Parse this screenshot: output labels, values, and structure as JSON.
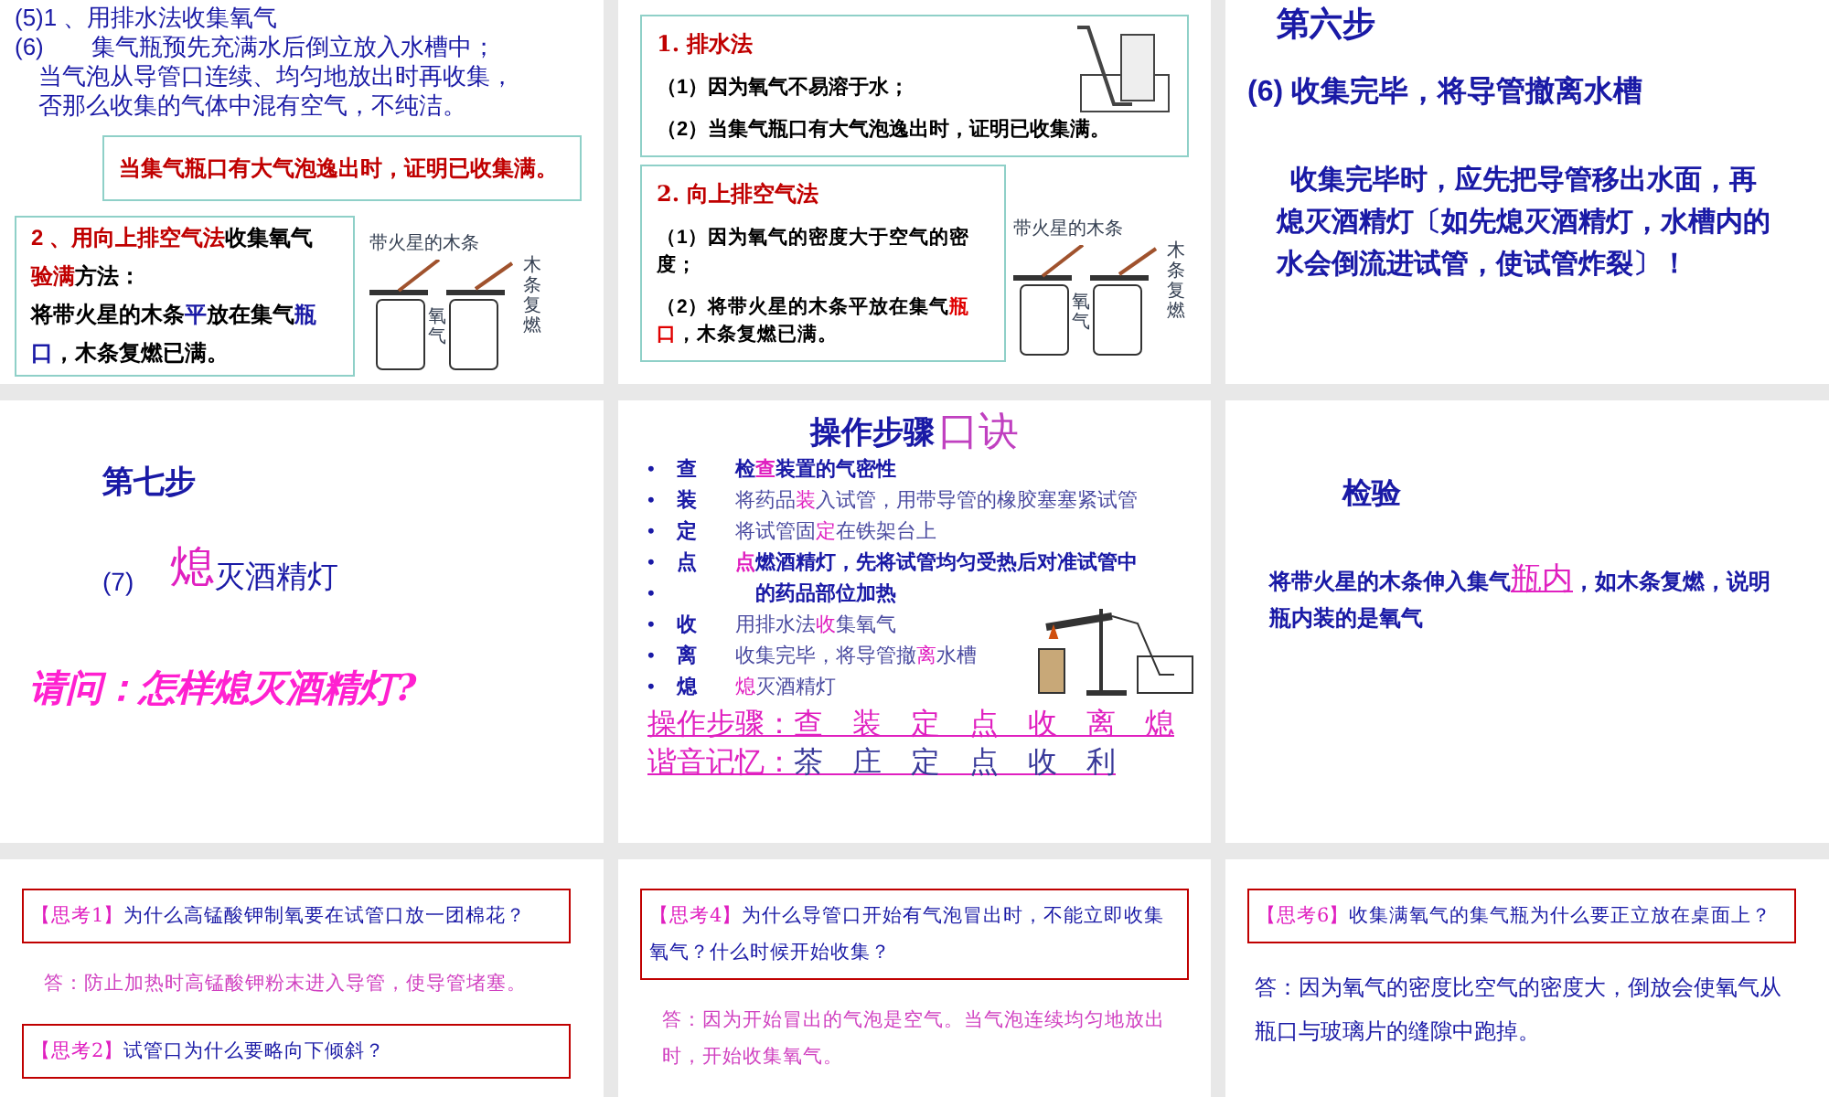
{
  "slides": [
    {
      "kind": "water-method",
      "lines": [
        [
          {
            "t": "(5)1 、用排水法收集氧气",
            "color": "#1a1aa6"
          }
        ],
        [
          {
            "t": "(6)　　集气瓶预先充满水后倒立放入水槽中；",
            "color": "#1a1aa6"
          }
        ],
        [
          {
            "t": "　当气泡从导管口连续、均匀地放出时再收集，",
            "color": "#1a1aa6"
          }
        ],
        [
          {
            "t": "　否那么收集的气体中混有空气，不纯洁。",
            "color": "#1a1aa6"
          }
        ]
      ],
      "note": "当集气瓶口有大气泡逸出时，证明已收集满。",
      "box": [
        [
          {
            "t": "2 、用",
            "color": "#c00000"
          },
          {
            "t": "向上排空气法",
            "color": "#c00000"
          },
          {
            "t": "收集氧气",
            "color": "#000000"
          }
        ],
        [
          {
            "t": "验满",
            "color": "#c00000"
          },
          {
            "t": "方法：",
            "color": "#000000"
          }
        ],
        [
          {
            "t": "将带火星的木条",
            "color": "#000000"
          },
          {
            "t": "平",
            "color": "#1a1aa6"
          },
          {
            "t": "放在集气",
            "color": "#000000"
          },
          {
            "t": "瓶",
            "color": "#1a1aa6"
          }
        ],
        [
          {
            "t": "口",
            "color": "#1a1aa6"
          },
          {
            "t": "，木条复燃已满。",
            "color": "#000000"
          }
        ]
      ],
      "figure": {
        "top_label": "带火星的木条",
        "gas_label": "氧气",
        "side_label": "木条复燃"
      }
    },
    {
      "kind": "methods",
      "sections": [
        {
          "heading": "1.  排水法",
          "lines": [
            [
              {
                "t": "（1）因为氧气不易溶于水；",
                "color": "#000000"
              }
            ],
            [
              {
                "t": "（2）当集气瓶口有大气泡逸出时，证明已收集满。",
                "color": "#000000"
              }
            ]
          ]
        },
        {
          "heading": "2. 向上排空气法",
          "lines": [
            [
              {
                "t": "（1）因为氧气的密度大于空气的密度；",
                "color": "#000000"
              }
            ],
            [
              {
                "t": "（2）将带火星的木条平放在集气",
                "color": "#000000"
              },
              {
                "t": "瓶口",
                "color": "#e00000"
              },
              {
                "t": "，木条复燃已满。",
                "color": "#000000"
              }
            ]
          ]
        }
      ],
      "figure": {
        "top_label": "带火星的木条",
        "gas_label": "氧气",
        "side_label": "木条复燃"
      }
    },
    {
      "kind": "step",
      "title": "第六步",
      "step": "(6)  收集完毕，将导管撤离水槽",
      "body": "收集完毕时，应先把导管移出水面，再熄灭酒精灯〔如先熄灭酒精灯，水槽内的水会倒流进试管，使试管炸裂〕！"
    },
    {
      "kind": "step7",
      "title": "第七步",
      "number": "(7)",
      "key": "熄",
      "rest": "灭酒精灯",
      "question": "请问：怎样熄灭酒精灯?"
    },
    {
      "kind": "mnemonic",
      "title": "操作步骤",
      "title_accent": "口诀",
      "items": [
        {
          "marker": "•",
          "key": "查",
          "runs": [
            {
              "t": "检",
              "color": "#1a1aa6"
            },
            {
              "t": "查",
              "color": "#e020c0"
            },
            {
              "t": "装置的气密性",
              "color": "#1a1aa6"
            }
          ]
        },
        {
          "marker": "•",
          "key": "装",
          "runs": [
            {
              "t": "将药品",
              "color": "#4a4aa0"
            },
            {
              "t": "装",
              "color": "#e020c0"
            },
            {
              "t": "入试管，用带导管的橡胶塞塞紧试管",
              "color": "#4a4aa0"
            }
          ]
        },
        {
          "marker": "•",
          "key": "定",
          "runs": [
            {
              "t": "将试管固",
              "color": "#4a4aa0"
            },
            {
              "t": "定",
              "color": "#e020c0"
            },
            {
              "t": "在铁架台上",
              "color": "#4a4aa0"
            }
          ]
        },
        {
          "marker": "•",
          "key": "点",
          "runs": [
            {
              "t": "点",
              "color": "#e020c0"
            },
            {
              "t": "燃酒精灯，先将试管均匀受热后对准试管中",
              "color": "#1a1aa6"
            }
          ]
        },
        {
          "marker": "•",
          "runs": [
            {
              "t": "　的药品部位加热",
              "color": "#1a1aa6"
            }
          ]
        },
        {
          "marker": "•",
          "key": "收",
          "runs": [
            {
              "t": "用排水法",
              "color": "#4a4aa0"
            },
            {
              "t": "收",
              "color": "#e020c0"
            },
            {
              "t": "集氧气",
              "color": "#4a4aa0"
            }
          ]
        },
        {
          "marker": "•",
          "key": "离",
          "runs": [
            {
              "t": "收集完毕，将导管撤",
              "color": "#4a4aa0"
            },
            {
              "t": "离",
              "color": "#e020c0"
            },
            {
              "t": "水槽",
              "color": "#4a4aa0"
            }
          ]
        },
        {
          "marker": "•",
          "key": "熄",
          "runs": [
            {
              "t": "熄",
              "color": "#e020c0"
            },
            {
              "t": "灭酒精灯",
              "color": "#4a4aa0"
            }
          ]
        }
      ],
      "summary": "操作步骤：查　装　定　点　收　离　熄",
      "memo_label": "谐音记忆：",
      "memo": "茶　庄　定　点　收　利"
    },
    {
      "kind": "test",
      "title": "检验",
      "runs": [
        {
          "t": "将带火星的木条伸入集气",
          "color": "#1a1aa6"
        },
        {
          "t": "瓶内",
          "color": "#e020c0"
        },
        {
          "t": "，如木条复燃，说明瓶内装的是氧气",
          "color": "#1a1aa6"
        }
      ]
    },
    {
      "kind": "qa",
      "blocks": [
        {
          "kind": "question",
          "tag": "【思考1】",
          "text": "为什么高锰酸钾制氧要在试管口放一团棉花？"
        },
        {
          "kind": "answer",
          "text": "答：防止加热时高锰酸钾粉末进入导管，使导管堵塞。"
        },
        {
          "kind": "question",
          "tag": "【思考2】",
          "text": "试管口为什么要略向下倾斜？"
        }
      ]
    },
    {
      "kind": "qa",
      "blocks": [
        {
          "kind": "question",
          "tag": "【思考4】",
          "text": "为什么导管口开始有气泡冒出时，不能立即收集氧气？什么时候开始收集？"
        },
        {
          "kind": "answer",
          "text": "答：因为开始冒出的气泡是空气。当气泡连续均匀地放出时，开始收集氧气。"
        }
      ]
    },
    {
      "kind": "qa",
      "blocks": [
        {
          "kind": "question",
          "tag": "【思考6】",
          "text": "收集满氧气的集气瓶为什么要正立放在桌面上？"
        },
        {
          "kind": "answer-strong",
          "text": "答：因为氧气的密度比空气的密度大，倒放会使氧气从瓶口与玻璃片的缝隙中跑掉。"
        }
      ]
    }
  ]
}
